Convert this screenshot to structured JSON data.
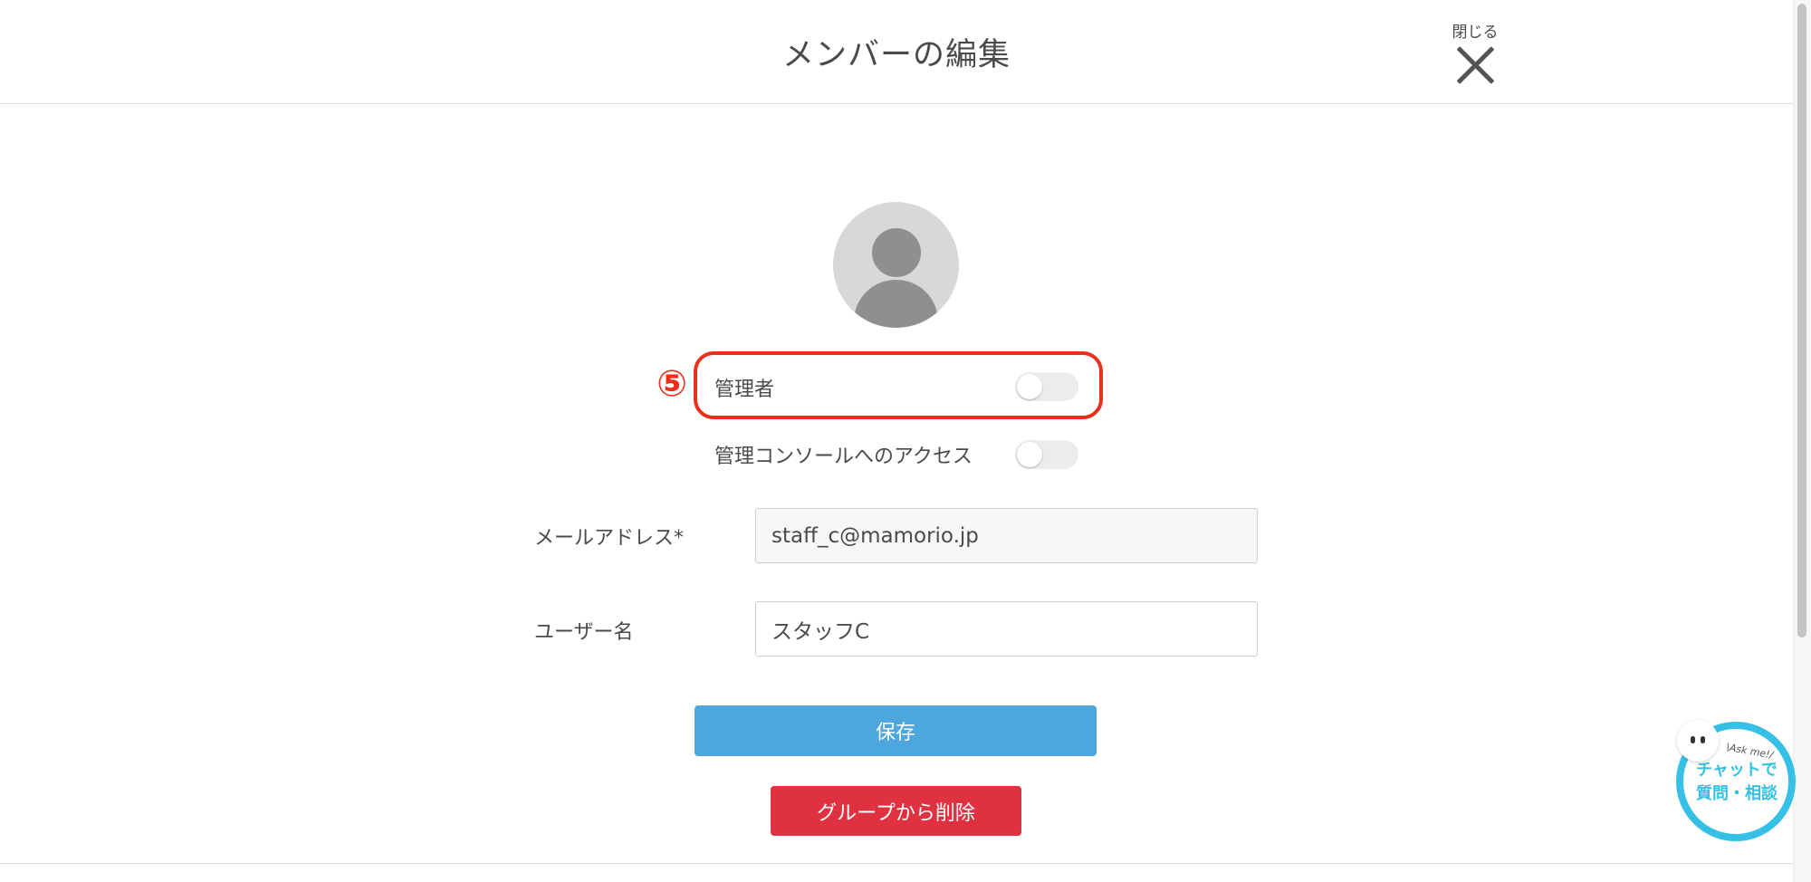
{
  "header": {
    "title": "メンバーの編集",
    "close_label": "閉じる"
  },
  "annotation": {
    "step_number": "⑤"
  },
  "toggles": [
    {
      "label": "管理者",
      "on": false
    },
    {
      "label": "管理コンソールへのアクセス",
      "on": false
    }
  ],
  "fields": {
    "email": {
      "label": "メールアドレス*",
      "value": "staff_c@mamorio.jp",
      "editable": false
    },
    "username": {
      "label": "ユーザー名",
      "value": "スタッフC",
      "editable": true
    }
  },
  "buttons": {
    "save_label": "保存",
    "delete_label": "グループから削除"
  },
  "chat_widget": {
    "ask_text": "\\Ask me!/",
    "line1": "チャットで",
    "line2": "質問・相談"
  },
  "colors": {
    "save_button": "#4da7dc",
    "delete_button": "#e03141",
    "highlight": "#e8301c",
    "chat_accent": "#36c0e6"
  }
}
